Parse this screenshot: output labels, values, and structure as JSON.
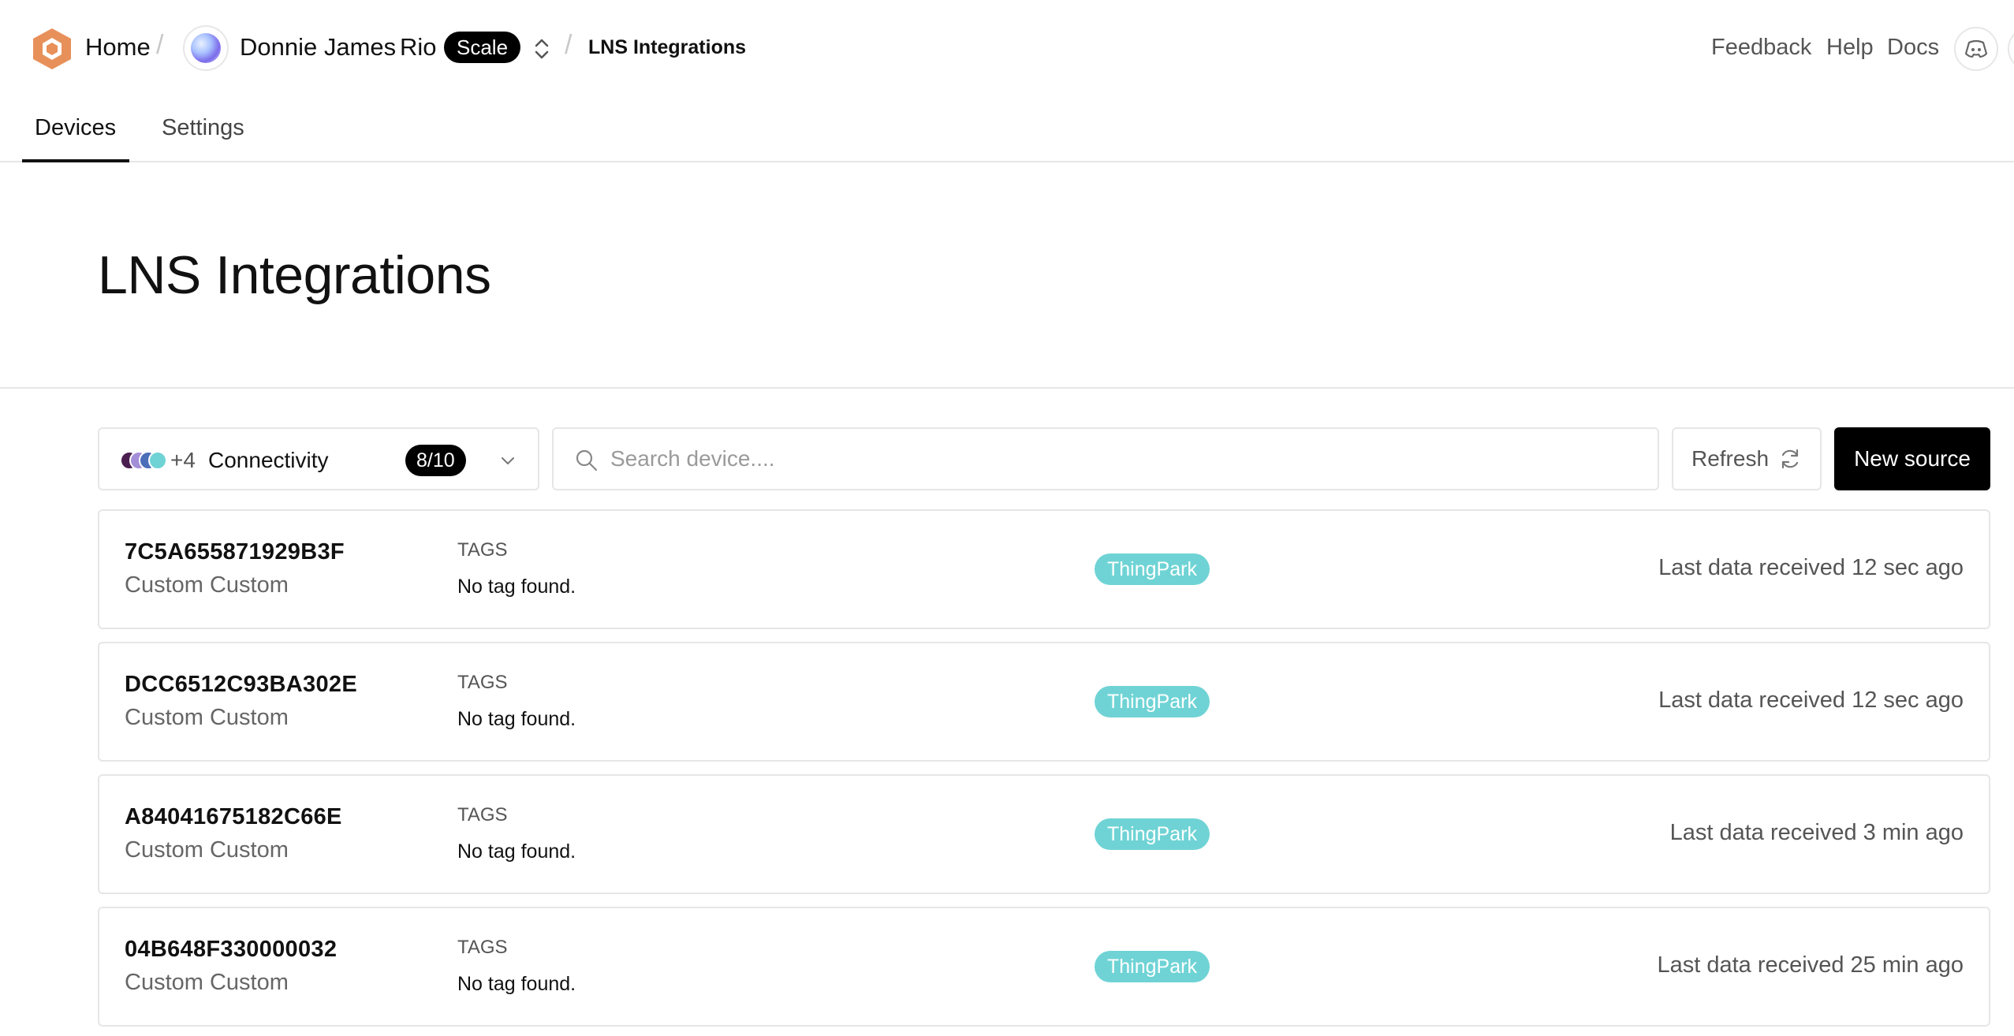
{
  "header": {
    "home_label": "Home",
    "separator": "/",
    "org_name": "Donnie James",
    "project_name": "Rio",
    "plan_badge": "Scale",
    "current_page": "LNS Integrations",
    "links": {
      "feedback": "Feedback",
      "help": "Help",
      "docs": "Docs"
    }
  },
  "tabs": [
    {
      "label": "Devices",
      "active": true
    },
    {
      "label": "Settings",
      "active": false
    }
  ],
  "page": {
    "title": "LNS Integrations"
  },
  "toolbar": {
    "filter_extra_count": "+4",
    "filter_label": "Connectivity",
    "filter_count": "8/10",
    "filter_colors": [
      "#4a1e4f",
      "#a38ed8",
      "#4a6fb8",
      "#6fd3d5"
    ],
    "search_placeholder": "Search device....",
    "refresh_label": "Refresh",
    "new_source_label": "New source"
  },
  "devices": [
    {
      "id": "7C5A655871929B3F",
      "model": "Custom Custom",
      "tags_label": "TAGS",
      "tags_value": "No tag found.",
      "network": "ThingPark",
      "last_seen": "Last data received 12 sec ago"
    },
    {
      "id": "DCC6512C93BA302E",
      "model": "Custom Custom",
      "tags_label": "TAGS",
      "tags_value": "No tag found.",
      "network": "ThingPark",
      "last_seen": "Last data received 12 sec ago"
    },
    {
      "id": "A84041675182C66E",
      "model": "Custom Custom",
      "tags_label": "TAGS",
      "tags_value": "No tag found.",
      "network": "ThingPark",
      "last_seen": "Last data received 3 min ago"
    },
    {
      "id": "04B648F330000032",
      "model": "Custom Custom",
      "tags_label": "TAGS",
      "tags_value": "No tag found.",
      "network": "ThingPark",
      "last_seen": "Last data received 25 min ago"
    }
  ],
  "colors": {
    "accent_logo": "#e8905a",
    "network_badge": "#6fd3d5",
    "primary_button": "#000000"
  }
}
